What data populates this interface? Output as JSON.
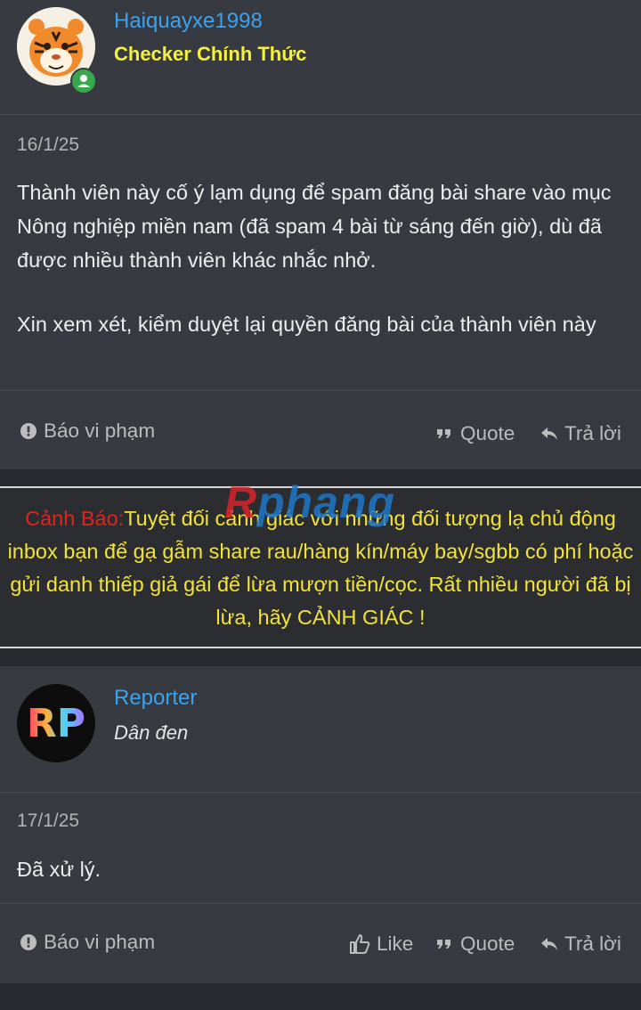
{
  "posts": [
    {
      "username": "Haiquayxe1998",
      "user_title": "Checker Chính Thức",
      "date": "16/1/25",
      "paragraphs": [
        "Thành viên này cố ý lạm dụng để spam đăng bài share vào mục Nông nghiệp miền nam (đã spam 4 bài từ sáng đến giờ), dù đã được nhiều thành viên khác nhắc nhở.",
        "Xin xem xét, kiểm duyệt lại quyền đăng bài của thành viên này"
      ],
      "actions": {
        "report": "Báo vi phạm",
        "quote": "Quote",
        "reply": "Trả lời"
      }
    },
    {
      "username": "Reporter",
      "user_title": "Dân đen",
      "avatar_text": "RP",
      "date": "17/1/25",
      "paragraphs": [
        "Đã xử lý."
      ],
      "actions": {
        "report": "Báo vi phạm",
        "like": "Like",
        "quote": "Quote",
        "reply": "Trả lời"
      }
    }
  ],
  "warning": {
    "label": "Cảnh Báo:",
    "text": "Tuyệt đối cảnh giác với những đối tượng lạ chủ động inbox bạn để gạ gẫm share rau/hàng kín/máy bay/sgbb có phí hoặc gửi danh thiếp giả gái để lừa mượn tiền/cọc. Rất nhiều người đã bị lừa, hãy CẢNH GIÁC !",
    "watermark_part1": "R",
    "watermark_part2": "phang"
  },
  "colors": {
    "username": "#3aa3f0",
    "checker_title": "#f5f03a",
    "warning_text": "#f2e23a",
    "warning_label": "#e0251f",
    "online_badge": "#37a84c"
  },
  "icons": [
    "avatar-tiger",
    "online-status-icon",
    "report-icon",
    "quote-icon",
    "reply-icon",
    "like-icon"
  ]
}
